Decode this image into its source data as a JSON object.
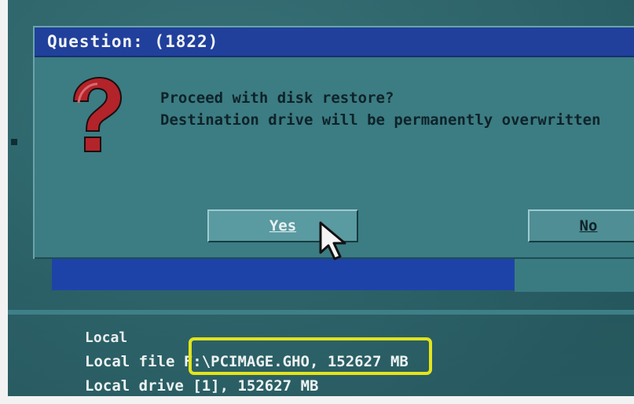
{
  "dialog": {
    "title": "Question: (1822)",
    "icon": "question-mark-icon",
    "message_lines": [
      "Proceed with disk restore?",
      "Destination drive will be permanently overwritten"
    ],
    "buttons": {
      "yes_label": "Yes",
      "no_label": "No"
    }
  },
  "info_panel": {
    "heading": "Local",
    "local_file_label": "Local file",
    "local_file_value": "F:\\PCIMAGE.GHO, 152627 MB",
    "local_drive_label": "Local drive",
    "local_drive_value": "[1], 152627 MB"
  },
  "colors": {
    "titlebar": "#20409c",
    "dialog_bg": "#3c7c83",
    "screen_bg": "#2b6a70",
    "highlight": "#e3e41c",
    "question_mark": "#b3232a"
  }
}
